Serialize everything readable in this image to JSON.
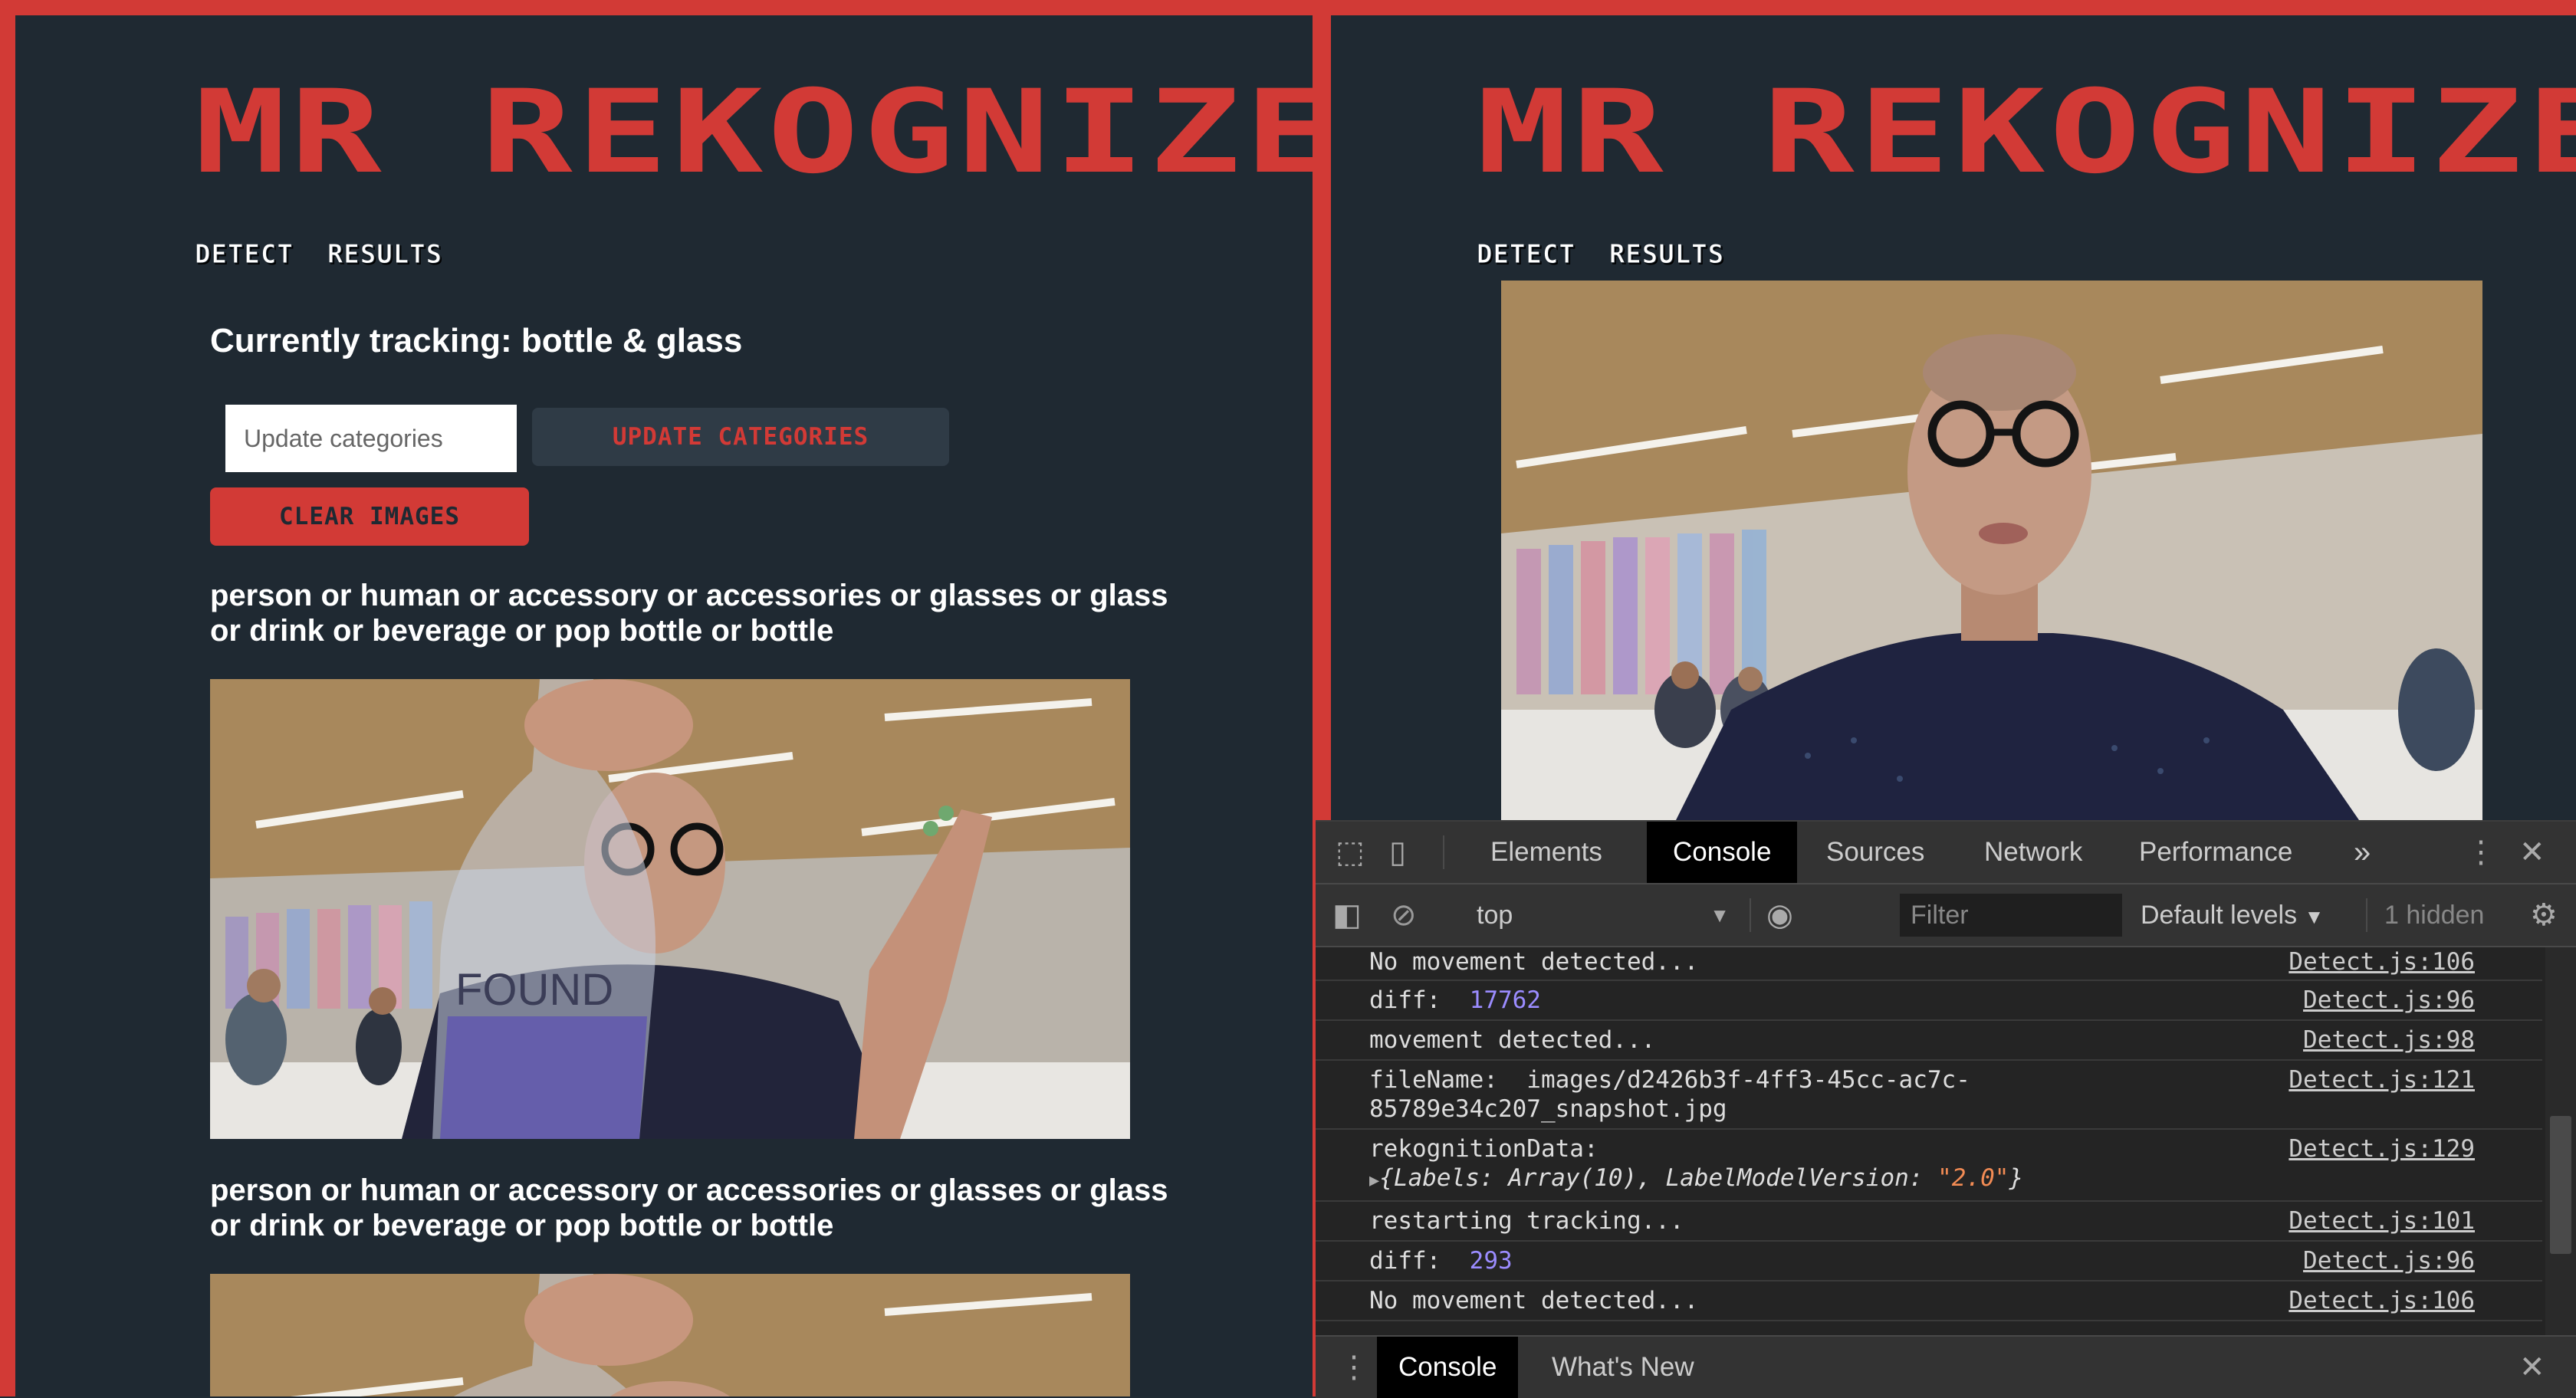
{
  "app": {
    "title": "MR REKOGNIZER",
    "nav": [
      "DETECT",
      "RESULTS"
    ],
    "accent_color": "#d23a36",
    "background_color": "#1f2932"
  },
  "left": {
    "tracking_text": "Currently tracking: bottle & glass",
    "category_input": {
      "value": "",
      "placeholder": "Update categories"
    },
    "update_button": "UPDATE CATEGORIES",
    "clear_button": "CLEAR IMAGES",
    "results": [
      {
        "labels": "person or human or accessory or accessories or glasses or glass or drink or beverage or pop bottle or bottle"
      },
      {
        "labels": "person or human or accessory or accessories or glasses or glass or drink or beverage or pop bottle or bottle"
      }
    ],
    "photo_text": "FOUND"
  },
  "devtools": {
    "tabs": [
      "Elements",
      "Console",
      "Sources",
      "Network",
      "Performance"
    ],
    "active_tab": "Console",
    "more_tabs_icon": "double-chevron-icon",
    "context": "top",
    "filter": {
      "value": "",
      "placeholder": "Filter"
    },
    "levels": "Default levels",
    "hidden_count": "1 hidden",
    "logs": [
      {
        "text": "No movement detected...",
        "source": "Detect.js:106"
      },
      {
        "text": "diff:",
        "value": "17762",
        "source": "Detect.js:96"
      },
      {
        "text": "movement detected...",
        "source": "Detect.js:98"
      },
      {
        "text": "fileName:  images/d2426b3f-4ff3-45cc-ac7c-85789e34c207_snapshot.jpg",
        "source": "Detect.js:121"
      },
      {
        "text": "rekognitionData:",
        "object_keys": "{Labels: Array(10), LabelModelVersion: ",
        "object_string": "\"2.0\"",
        "object_close": "}",
        "source": "Detect.js:129"
      },
      {
        "text": "restarting tracking...",
        "source": "Detect.js:101"
      },
      {
        "text": "diff:",
        "value": "293",
        "source": "Detect.js:96"
      },
      {
        "text": "No movement detected...",
        "source": "Detect.js:106"
      }
    ],
    "drawer_tabs": [
      "Console",
      "What's New"
    ]
  }
}
